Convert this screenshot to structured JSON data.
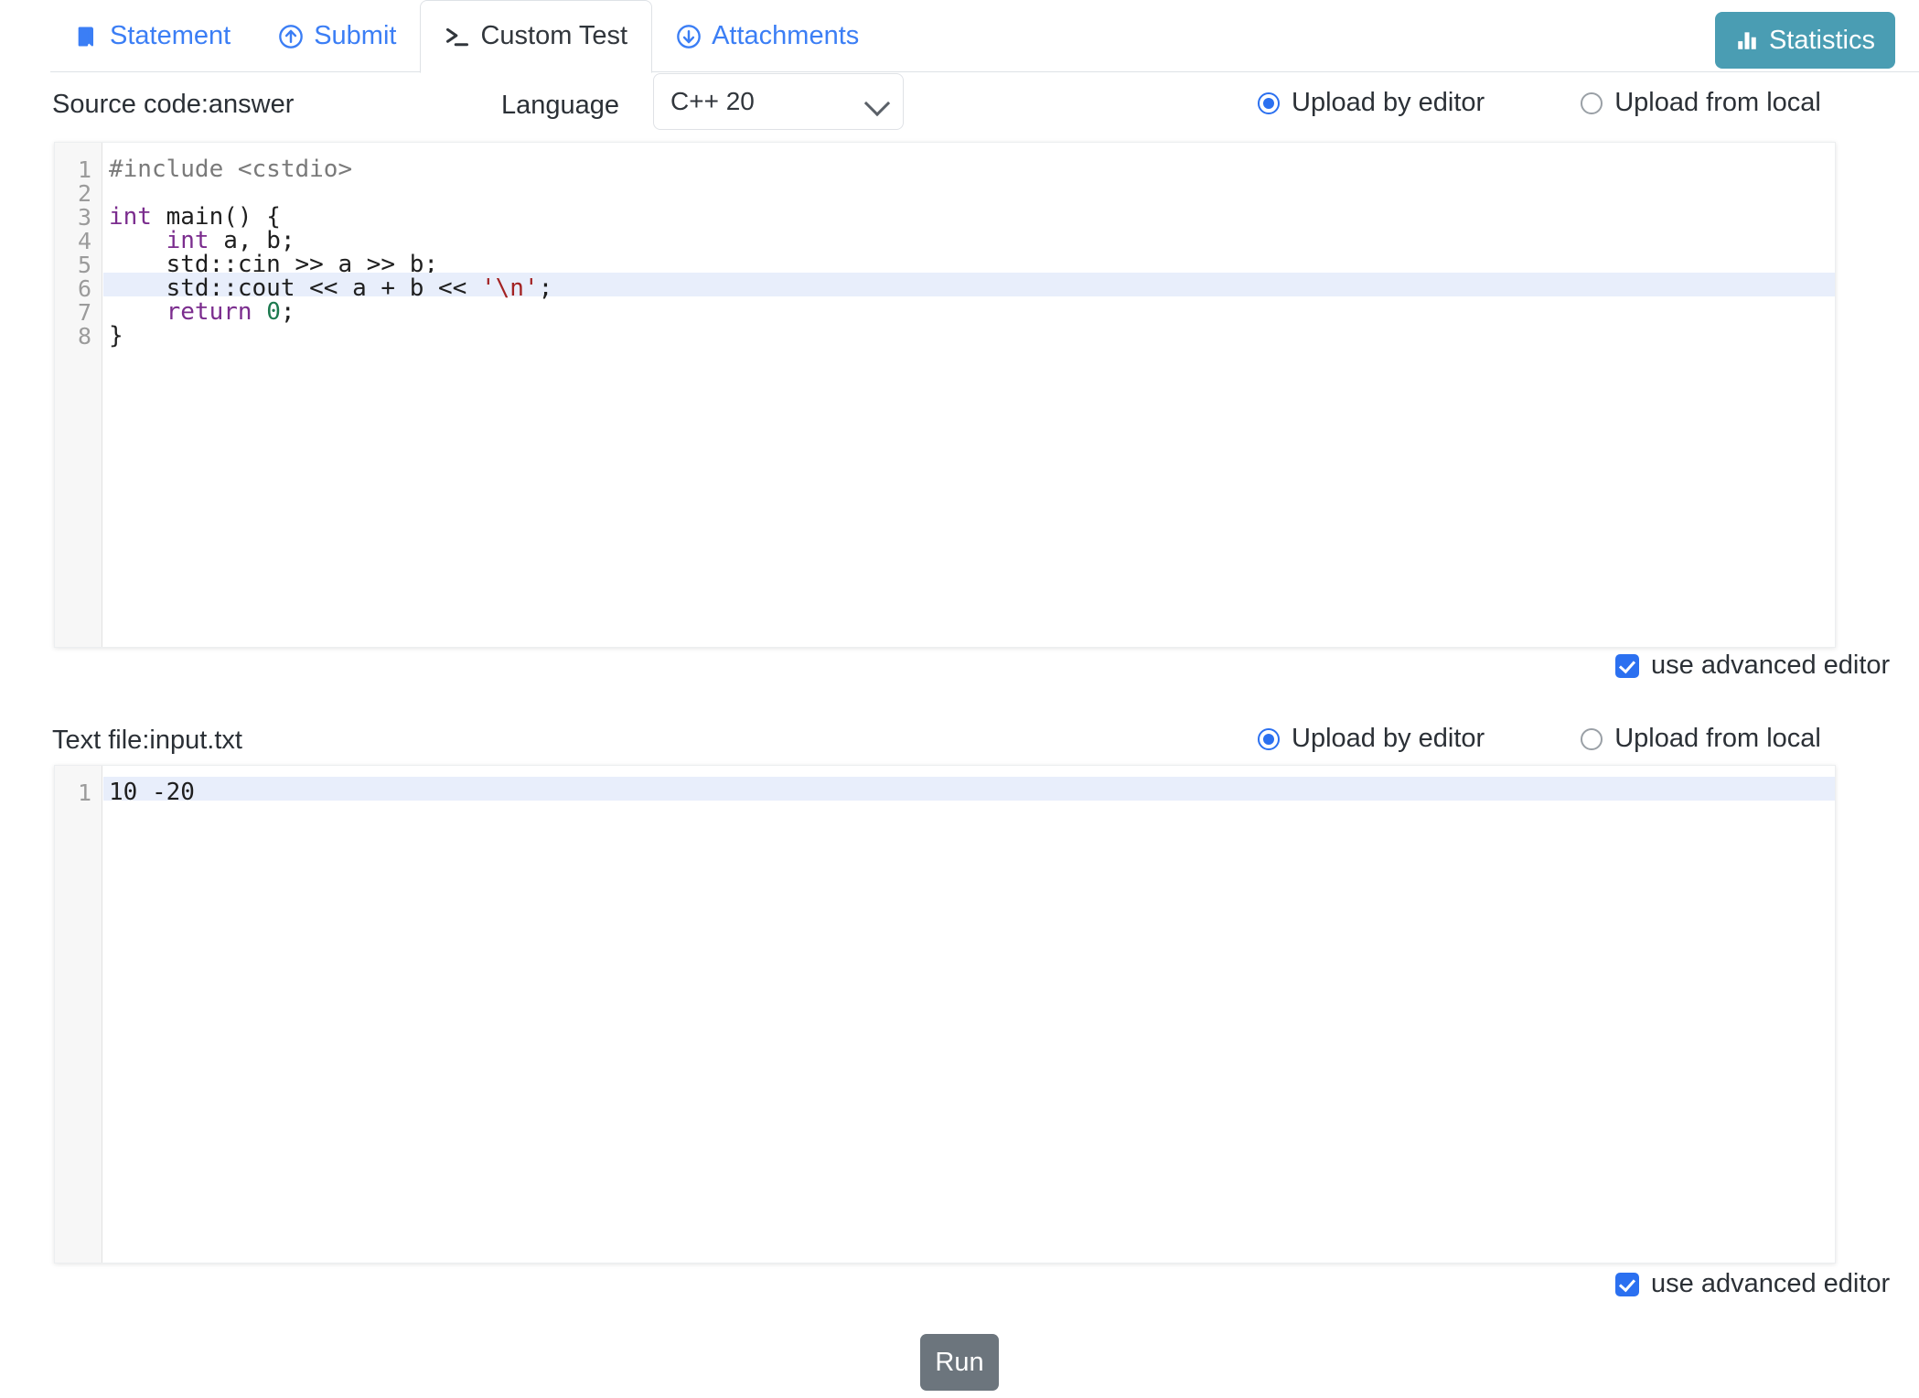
{
  "tabs": [
    {
      "label": "Statement",
      "icon": "book-icon",
      "active": false
    },
    {
      "label": "Submit",
      "icon": "arrow-up-circle-icon",
      "active": false
    },
    {
      "label": "Custom Test",
      "icon": "terminal-icon",
      "active": true
    },
    {
      "label": "Attachments",
      "icon": "arrow-down-circle-icon",
      "active": false
    }
  ],
  "statistics_button": {
    "label": "Statistics",
    "icon": "bar-chart-icon",
    "color": "#4a9db3"
  },
  "source": {
    "label": "Source code:answer",
    "language_label": "Language",
    "language_value": "C++ 20",
    "language_options": [
      "C++ 20"
    ],
    "caret_icon": "chevron-down-icon",
    "upload_by_editor": "Upload by editor",
    "upload_from_local": "Upload from local",
    "selected_upload_mode": "Upload by editor",
    "advanced_editor_label": "use advanced editor",
    "advanced_editor_checked": true,
    "code_lines": [
      {
        "n": "1",
        "tokens": [
          {
            "t": "#include <cstdio>",
            "c": "tok-pre"
          }
        ]
      },
      {
        "n": "2",
        "tokens": [
          {
            "t": "",
            "c": "tok-plain"
          }
        ]
      },
      {
        "n": "3",
        "tokens": [
          {
            "t": "int",
            "c": "tok-kw"
          },
          {
            "t": " main() {",
            "c": "tok-plain"
          }
        ]
      },
      {
        "n": "4",
        "tokens": [
          {
            "t": "    ",
            "c": "tok-plain"
          },
          {
            "t": "int",
            "c": "tok-kw"
          },
          {
            "t": " a, b;",
            "c": "tok-plain"
          }
        ]
      },
      {
        "n": "5",
        "tokens": [
          {
            "t": "    std::cin >> a >> b;",
            "c": "tok-plain"
          }
        ]
      },
      {
        "n": "6",
        "tokens": [
          {
            "t": "    std::cout << a + b << ",
            "c": "tok-plain"
          },
          {
            "t": "'\\n'",
            "c": "tok-str"
          },
          {
            "t": ";",
            "c": "tok-plain"
          }
        ],
        "highlight": true
      },
      {
        "n": "7",
        "tokens": [
          {
            "t": "    ",
            "c": "tok-plain"
          },
          {
            "t": "return",
            "c": "tok-kw"
          },
          {
            "t": " ",
            "c": "tok-plain"
          },
          {
            "t": "0",
            "c": "tok-num"
          },
          {
            "t": ";",
            "c": "tok-plain"
          }
        ]
      },
      {
        "n": "8",
        "tokens": [
          {
            "t": "}",
            "c": "tok-plain"
          }
        ]
      }
    ]
  },
  "textfile": {
    "label": "Text file:input.txt",
    "upload_by_editor": "Upload by editor",
    "upload_from_local": "Upload from local",
    "selected_upload_mode": "Upload by editor",
    "advanced_editor_label": "use advanced editor",
    "advanced_editor_checked": true,
    "code_lines": [
      {
        "n": "1",
        "tokens": [
          {
            "t": "10 -20",
            "c": "tok-plain"
          }
        ],
        "highlight": true
      }
    ]
  },
  "run_button": {
    "label": "Run",
    "color": "#6c757d"
  }
}
